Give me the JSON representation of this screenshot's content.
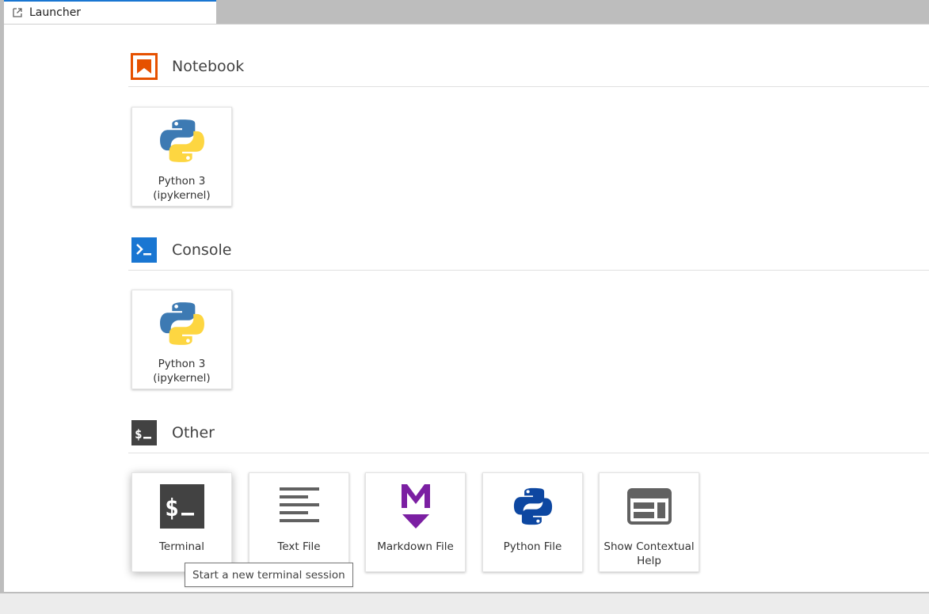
{
  "tab": {
    "title": "Launcher",
    "icon": "launch-icon"
  },
  "sections": {
    "notebook": {
      "title": "Notebook",
      "icon": "notebook-icon",
      "color": "#e65100",
      "cards": [
        {
          "line1": "Python 3",
          "line2": "(ipykernel)",
          "icon": "python-logo-icon"
        }
      ]
    },
    "console": {
      "title": "Console",
      "icon": "console-icon",
      "color": "#1976d2",
      "cards": [
        {
          "line1": "Python 3",
          "line2": "(ipykernel)",
          "icon": "python-logo-icon"
        }
      ]
    },
    "other": {
      "title": "Other",
      "icon": "terminal-icon",
      "color": "#424242",
      "cards": [
        {
          "label": "Terminal",
          "icon": "terminal-icon"
        },
        {
          "label": "Text File",
          "icon": "text-file-icon"
        },
        {
          "label": "Markdown File",
          "icon": "markdown-icon"
        },
        {
          "label": "Python File",
          "icon": "python-file-icon"
        },
        {
          "line1": "Show Contextual",
          "line2": "Help",
          "icon": "contextual-help-icon"
        }
      ]
    }
  },
  "tooltip": {
    "text": "Start a new terminal session"
  },
  "colors": {
    "python_blue": "#3d7ab3",
    "python_yellow": "#fdd641",
    "markdown_purple": "#7b1fa2",
    "python_file_blue": "#0d47a1",
    "terminal_dark": "#424242"
  }
}
